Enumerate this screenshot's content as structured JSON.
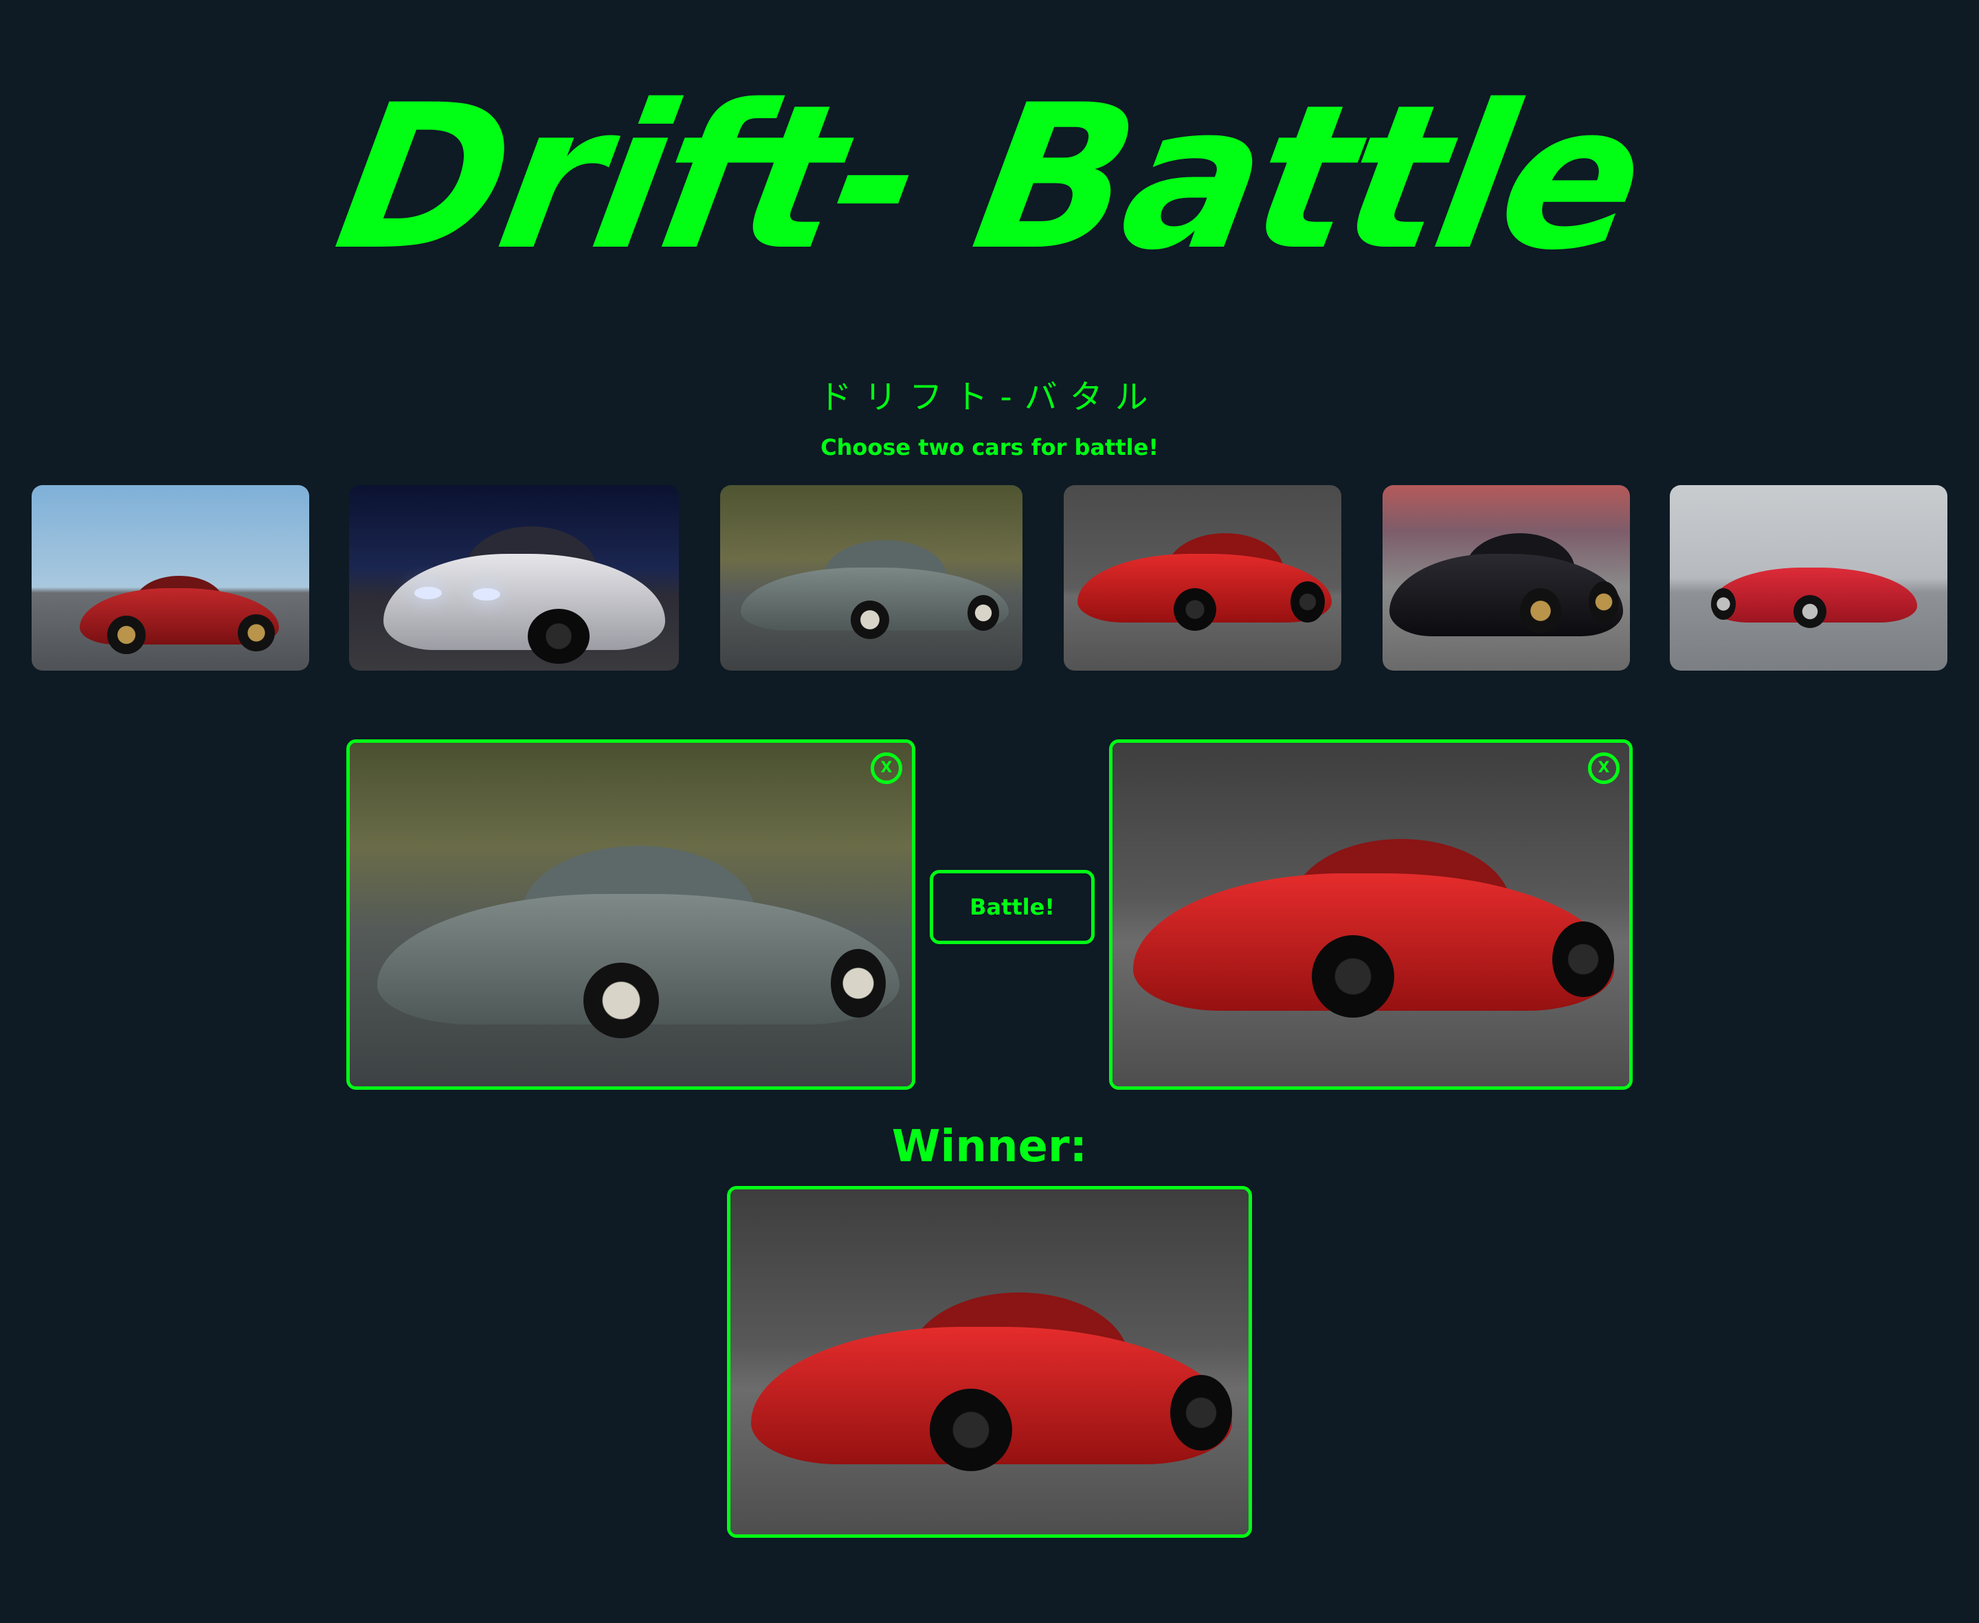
{
  "header": {
    "title": "Drift- Battle",
    "subtitle_jp": "ドリフト-バタル",
    "instruction": "Choose two cars for battle!"
  },
  "colors": {
    "background": "#0e1a24",
    "accent": "#00ff15"
  },
  "gallery": [
    {
      "name": "red-rx7-thumb"
    },
    {
      "name": "white-silvia-thumb"
    },
    {
      "name": "grey-ae86-thumb"
    },
    {
      "name": "red-350z-thumb"
    },
    {
      "name": "black-supra-thumb"
    },
    {
      "name": "red-miata-thumb"
    }
  ],
  "battle": {
    "close_label": "X",
    "button_label": "Battle!",
    "winner_label": "Winner:"
  }
}
